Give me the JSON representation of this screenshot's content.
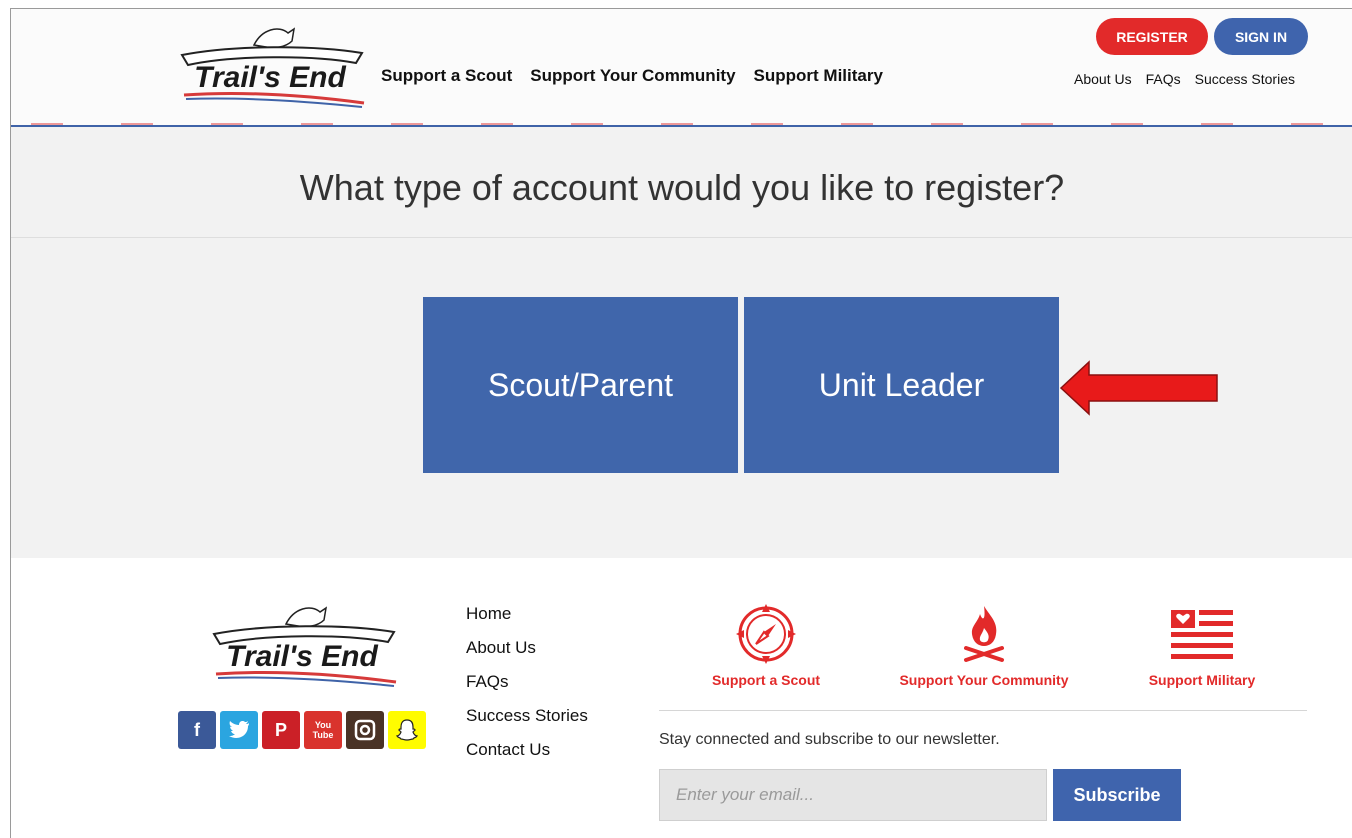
{
  "header": {
    "logo_text": "Trail's End",
    "nav": [
      "Support a Scout",
      "Support Your Community",
      "Support Military"
    ],
    "register_label": "REGISTER",
    "signin_label": "SIGN IN",
    "top_links": [
      "About Us",
      "FAQs",
      "Success Stories"
    ]
  },
  "main": {
    "title": "What type of account would you like to register?",
    "options": [
      "Scout/Parent",
      "Unit Leader"
    ]
  },
  "footer": {
    "logo_text": "Trail's End",
    "links": [
      "Home",
      "About Us",
      "FAQs",
      "Success Stories",
      "Contact Us"
    ],
    "social": [
      {
        "icon": "facebook-icon",
        "glyph": "f",
        "color": "#3b5998"
      },
      {
        "icon": "twitter-icon",
        "glyph": "t",
        "color": "#2ba5e0"
      },
      {
        "icon": "pinterest-icon",
        "glyph": "p",
        "color": "#cb2027"
      },
      {
        "icon": "youtube-icon",
        "glyph": "You Tube",
        "color": "#d9332d"
      },
      {
        "icon": "instagram-icon",
        "glyph": "◘",
        "color": "#4a3326"
      },
      {
        "icon": "snapchat-icon",
        "glyph": "👻",
        "color": "#fffc00"
      }
    ],
    "features": [
      "Support a Scout",
      "Support Your Community",
      "Support Military"
    ],
    "newsletter_text": "Stay connected and subscribe to our newsletter.",
    "email_placeholder": "Enter your email...",
    "subscribe_label": "Subscribe"
  },
  "colors": {
    "brand_blue": "#4066ab",
    "brand_red": "#e22a2a"
  }
}
